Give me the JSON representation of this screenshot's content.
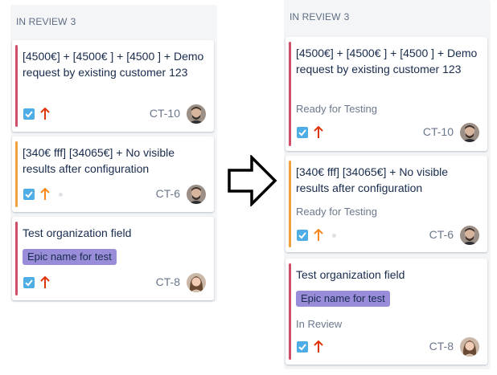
{
  "left_column": {
    "title": "IN REVIEW",
    "count": "3",
    "cards": [
      {
        "summary": "[4500€] + [4500€ ] + [4500 ] + Demo request by existing customer 123",
        "key": "CT-10",
        "priority": "high",
        "priority_color": "#de350b",
        "bar_color": "#d04f68",
        "avatar": "avatar-man-beard"
      },
      {
        "summary": "[340€ fff] [34065€] + No visible results after configuration",
        "key": "CT-6",
        "priority": "medium",
        "priority_color": "#f6891f",
        "bar_color": "#f0a03c",
        "avatar": "avatar-man-beard"
      },
      {
        "summary": "Test organization field",
        "epic": "Epic name for test",
        "key": "CT-8",
        "priority": "high",
        "priority_color": "#de350b",
        "bar_color": "#d04f68",
        "avatar": "avatar-woman"
      }
    ]
  },
  "right_column": {
    "title": "IN REVIEW",
    "count": "3",
    "cards": [
      {
        "summary": "[4500€] + [4500€ ] + [4500 ] + Demo request by existing customer 123",
        "status": "Ready for Testing",
        "key": "CT-10",
        "priority": "high",
        "priority_color": "#de350b",
        "bar_color": "#d04f68",
        "avatar": "avatar-man-beard"
      },
      {
        "summary": "[340€ fff] [34065€] + No visible results after configuration",
        "status": "Ready for Testing",
        "key": "CT-6",
        "priority": "medium",
        "priority_color": "#f6891f",
        "bar_color": "#f0a03c",
        "avatar": "avatar-man-beard"
      },
      {
        "summary": "Test organization field",
        "epic": "Epic name for test",
        "status": "In Review",
        "key": "CT-8",
        "priority": "high",
        "priority_color": "#de350b",
        "bar_color": "#d04f68",
        "avatar": "avatar-woman"
      }
    ]
  },
  "transition_icon": "right-arrow-outline-icon",
  "colors": {
    "checkbox": "#4fade6",
    "epic_bg": "#998dd9",
    "column_bg": "#f4f5f7"
  }
}
